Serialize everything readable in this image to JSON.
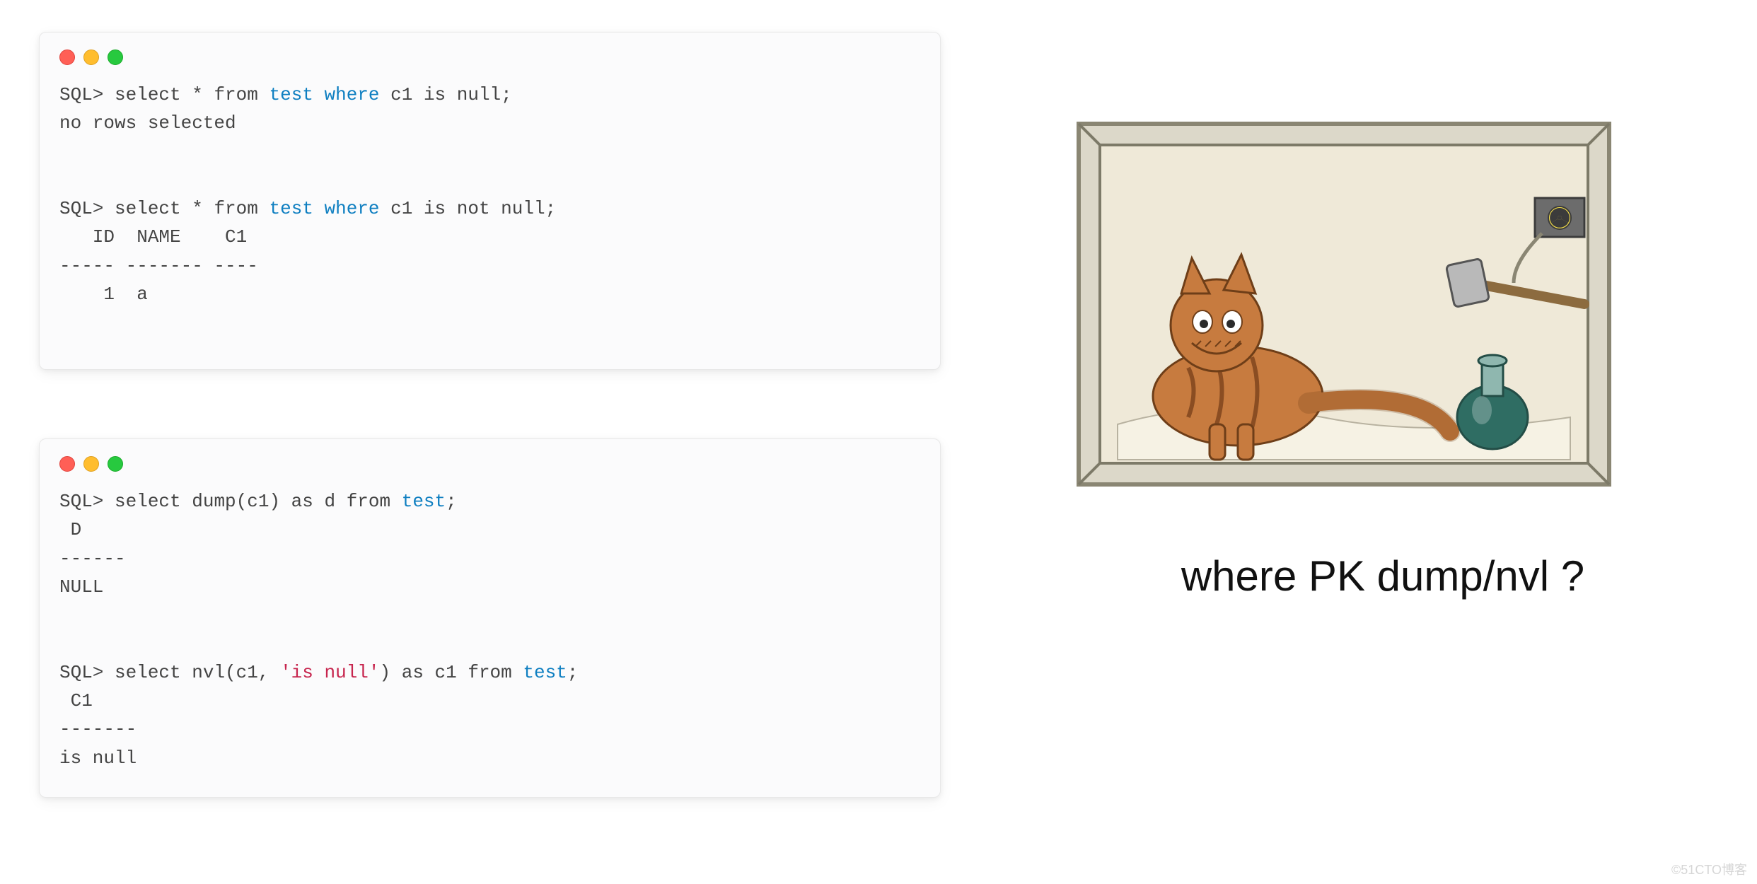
{
  "cards": {
    "card1": {
      "tokens": [
        {
          "t": "SQL> "
        },
        {
          "t": "select"
        },
        {
          "t": " * "
        },
        {
          "t": "from"
        },
        {
          "t": " "
        },
        {
          "t": "test",
          "c": "kw"
        },
        {
          "t": " "
        },
        {
          "t": "where",
          "c": "kw"
        },
        {
          "t": " c1 is null;"
        },
        {
          "t": "\n"
        },
        {
          "t": "no rows selected"
        },
        {
          "t": "\n\n\n"
        },
        {
          "t": "SQL> "
        },
        {
          "t": "select"
        },
        {
          "t": " * "
        },
        {
          "t": "from"
        },
        {
          "t": " "
        },
        {
          "t": "test",
          "c": "kw"
        },
        {
          "t": " "
        },
        {
          "t": "where",
          "c": "kw"
        },
        {
          "t": " c1 is not null;"
        },
        {
          "t": "\n"
        },
        {
          "t": "   ID  NAME    C1"
        },
        {
          "t": "\n"
        },
        {
          "t": "----- ------- ----"
        },
        {
          "t": "\n"
        },
        {
          "t": "    1  a"
        }
      ]
    },
    "card2": {
      "tokens": [
        {
          "t": "SQL> "
        },
        {
          "t": "select"
        },
        {
          "t": " dump(c1) as d "
        },
        {
          "t": "from"
        },
        {
          "t": " "
        },
        {
          "t": "test",
          "c": "kw"
        },
        {
          "t": ";"
        },
        {
          "t": "\n"
        },
        {
          "t": " D"
        },
        {
          "t": "\n"
        },
        {
          "t": "------"
        },
        {
          "t": "\n"
        },
        {
          "t": "NULL"
        },
        {
          "t": "\n\n\n"
        },
        {
          "t": "SQL> "
        },
        {
          "t": "select"
        },
        {
          "t": " nvl(c1, "
        },
        {
          "t": "'is null'",
          "c": "str"
        },
        {
          "t": ") as c1 "
        },
        {
          "t": "from"
        },
        {
          "t": " "
        },
        {
          "t": "test",
          "c": "kw"
        },
        {
          "t": ";"
        },
        {
          "t": "\n"
        },
        {
          "t": " C1"
        },
        {
          "t": "\n"
        },
        {
          "t": "-------"
        },
        {
          "t": "\n"
        },
        {
          "t": "is null"
        }
      ]
    }
  },
  "caption": "where PK dump/nvl ?",
  "watermark": "©51CTO博客",
  "illustration_alt": "Schrödinger's cat in a box with a hammer and poison flask triggered by a radioactive source"
}
